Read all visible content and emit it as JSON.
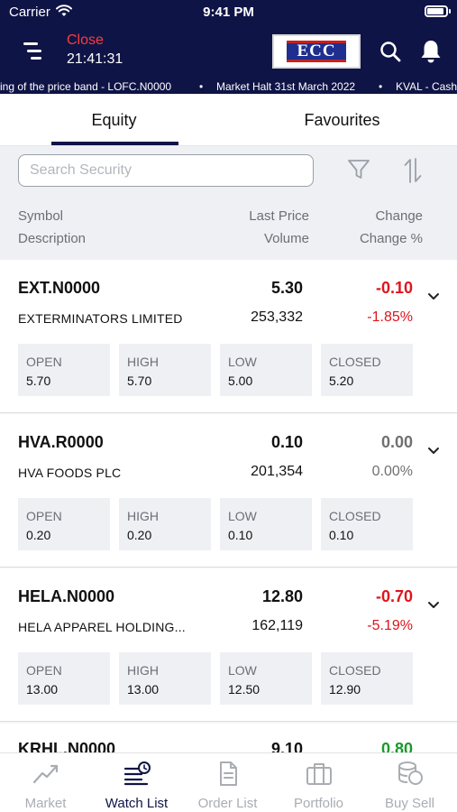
{
  "status_bar": {
    "carrier": "Carrier",
    "time": "9:41 PM"
  },
  "header": {
    "market_state": "Close",
    "clock": "21:41:31",
    "logo_text": "ECC",
    "ticker_items": [
      "ing of the price band - LOFC.N0000",
      "•",
      "Market Halt 31st March 2022",
      "•",
      "KVAL - Cash"
    ]
  },
  "tabs": [
    {
      "label": "Equity",
      "active": true
    },
    {
      "label": "Favourites",
      "active": false
    }
  ],
  "search": {
    "placeholder": "Search Security",
    "value": ""
  },
  "columns": {
    "symbol": "Symbol",
    "description": "Description",
    "last_price": "Last Price",
    "volume": "Volume",
    "change": "Change",
    "change_pct": "Change %"
  },
  "stat_labels": {
    "open": "OPEN",
    "high": "HIGH",
    "low": "LOW",
    "closed": "CLOSED"
  },
  "securities": [
    {
      "symbol": "EXT.N0000",
      "description": "EXTERMINATORS LIMITED",
      "last_price": "5.30",
      "volume": "253,332",
      "change": "-0.10",
      "change_pct": "-1.85%",
      "direction": "down",
      "open": "5.70",
      "high": "5.70",
      "low": "5.00",
      "closed": "5.20"
    },
    {
      "symbol": "HVA.R0000",
      "description": "HVA FOODS PLC",
      "last_price": "0.10",
      "volume": "201,354",
      "change": "0.00",
      "change_pct": "0.00%",
      "direction": "flat",
      "open": "0.20",
      "high": "0.20",
      "low": "0.10",
      "closed": "0.10"
    },
    {
      "symbol": "HELA.N0000",
      "description": "HELA APPAREL HOLDING...",
      "last_price": "12.80",
      "volume": "162,119",
      "change": "-0.70",
      "change_pct": "-5.19%",
      "direction": "down",
      "open": "13.00",
      "high": "13.00",
      "low": "12.50",
      "closed": "12.90"
    },
    {
      "symbol": "KRHL.N0000",
      "last_price": "9.10",
      "change": "0.80",
      "direction": "up"
    }
  ],
  "colors": {
    "header_bg": "#0f1446",
    "down": "#e0141c",
    "up": "#1a9a2a",
    "flat": "#707070"
  },
  "bottom_nav": [
    {
      "label": "Market",
      "icon": "trend-chart-icon",
      "active": false
    },
    {
      "label": "Watch List",
      "icon": "watchlist-clock-icon",
      "active": true
    },
    {
      "label": "Order List",
      "icon": "document-icon",
      "active": false
    },
    {
      "label": "Portfolio",
      "icon": "briefcase-icon",
      "active": false
    },
    {
      "label": "Buy Sell",
      "icon": "coins-icon",
      "active": false
    }
  ]
}
